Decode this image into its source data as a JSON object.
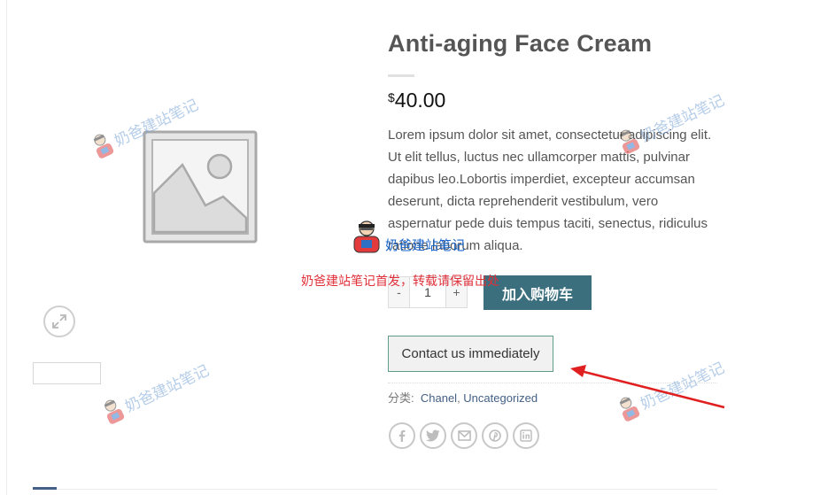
{
  "product": {
    "title": "Anti-aging Face Cream",
    "price_currency": "$",
    "price_value": "40.00",
    "description": "Lorem ipsum dolor sit amet, consectetur adipiscing elit. Ut elit tellus, luctus nec ullamcorper mattis, pulvinar dapibus leo.Lobortis imperdiet, excepteur accumsan deserunt, dicta reprehenderit vestibulum, vero aspernatur pede duis tempus taciti, senectus, ridiculus ratione laborum aliqua."
  },
  "cart": {
    "qty_minus": "-",
    "qty_value": "1",
    "qty_plus": "+",
    "add_to_cart_label": "加入购物车"
  },
  "contact": {
    "label": "Contact us immediately"
  },
  "meta": {
    "category_label": "分类:",
    "categories": [
      "Chanel",
      "Uncategorized"
    ],
    "separator": ", "
  },
  "share_icons": [
    "facebook-icon",
    "twitter-icon",
    "email-icon",
    "pinterest-icon",
    "linkedin-icon"
  ],
  "watermark": {
    "text": "奶爸建站笔记",
    "note": "奶爸建站笔记首发，转载请保留出处"
  },
  "colors": {
    "primary": "#446084",
    "cart_button": "#3b6f7d",
    "contact_border": "#5f9c8a",
    "annotation_red": "#e0303a"
  }
}
